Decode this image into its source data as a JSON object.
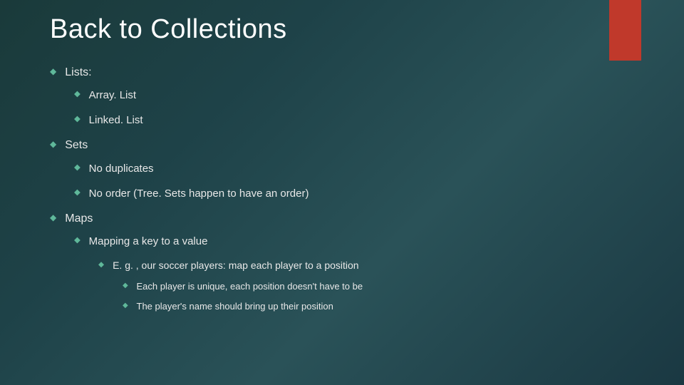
{
  "title": "Back to Collections",
  "bullet_glyph": "◆",
  "bullets": {
    "lists": {
      "label": "Lists:",
      "items": {
        "arraylist": "Array. List",
        "linkedlist": "Linked. List"
      }
    },
    "sets": {
      "label": "Sets",
      "items": {
        "nodup": "No duplicates",
        "noorder": "No order (Tree. Sets happen to have an order)"
      }
    },
    "maps": {
      "label": "Maps",
      "items": {
        "mapping": {
          "label": "Mapping a key to a value",
          "items": {
            "eg": {
              "label": "E. g. , our soccer players: map each player to a position",
              "items": {
                "unique": "Each player is unique, each position doesn't have to be",
                "name": "The player's name should bring up their position"
              }
            }
          }
        }
      }
    }
  }
}
